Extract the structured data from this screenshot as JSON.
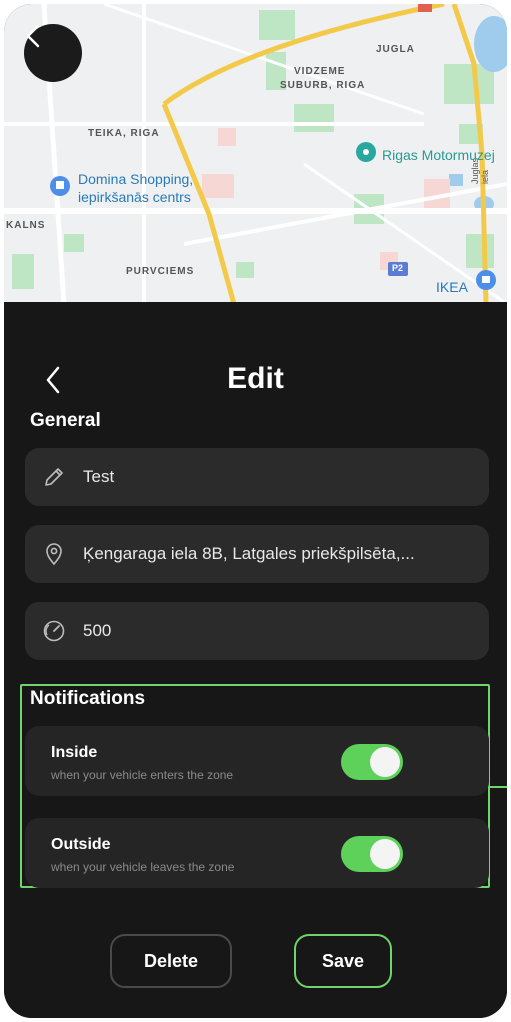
{
  "map": {
    "labels": {
      "jugla": "JUGLA",
      "vidzeme_line1": "VIDZEME",
      "vidzeme_line2": "SUBURB, RIGA",
      "teika": "TEIKA, RIGA",
      "kalns": "KALNS",
      "purvciems": "PURVCIEMS",
      "juglas_iela": "Juglas iela",
      "p2": "P2"
    },
    "poi": {
      "domina_line1": "Domina Shopping,",
      "domina_line2": "iepirkšanās centrs",
      "rigas": "Rigas Motormuzej",
      "ikea": "IKEA"
    },
    "colors": {
      "road": "#f3c94a",
      "park": "#bfe6c4",
      "water": "#9fcbed",
      "block": "#f7d7d3"
    }
  },
  "header": {
    "title": "Edit"
  },
  "general": {
    "title": "General",
    "name_value": "Test",
    "address_value": "Ķengaraga iela 8B, Latgales priekšpilsēta,...",
    "radius_value": "500"
  },
  "notifications": {
    "title": "Notifications",
    "inside": {
      "title": "Inside",
      "subtitle": "when your vehicle enters the zone",
      "enabled": true
    },
    "outside": {
      "title": "Outside",
      "subtitle": "when your vehicle leaves the zone",
      "enabled": true
    }
  },
  "actions": {
    "delete_label": "Delete",
    "save_label": "Save"
  },
  "colors": {
    "accent_green": "#5ed15a",
    "panel_bg": "#171717",
    "field_bg": "#2b2b2b"
  }
}
